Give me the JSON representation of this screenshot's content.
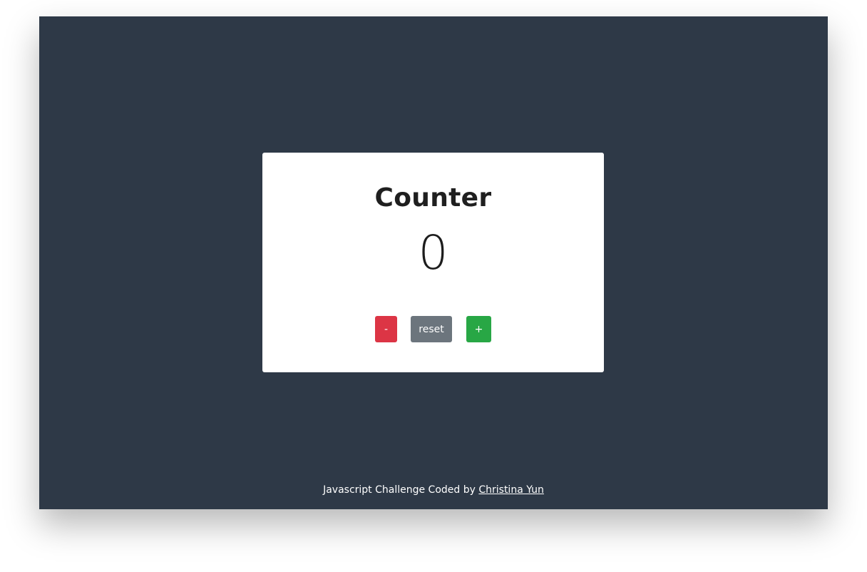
{
  "card": {
    "title": "Counter",
    "value": "0",
    "buttons": {
      "decrement": "-",
      "reset": "reset",
      "increment": "+"
    }
  },
  "footer": {
    "text": "Javascript Challenge Coded by ",
    "link_text": "Christina Yun"
  },
  "colors": {
    "background": "#2e3947",
    "card": "#ffffff",
    "decrement": "#dc3545",
    "reset": "#6c757d",
    "increment": "#28a745"
  }
}
